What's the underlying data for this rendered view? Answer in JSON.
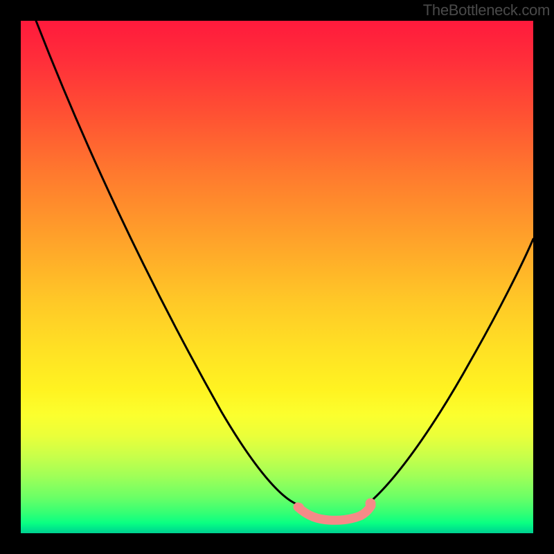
{
  "attribution": "TheBottleneck.com",
  "colors": {
    "background": "#000000",
    "curve": "#000000",
    "flat_segment": "#f58a88",
    "gradient_top": "#ff1a3c",
    "gradient_bottom": "#00d090"
  },
  "chart_data": {
    "type": "line",
    "title": "",
    "xlabel": "",
    "ylabel": "",
    "xlim": [
      0,
      100
    ],
    "ylim": [
      0,
      100
    ],
    "grid": false,
    "legend": false,
    "annotations": [],
    "series": [
      {
        "name": "left-curve",
        "x": [
          3,
          10,
          20,
          30,
          40,
          50,
          55
        ],
        "y": [
          100,
          82,
          62,
          44,
          27,
          12,
          6
        ]
      },
      {
        "name": "flat-segment",
        "x": [
          55,
          60,
          65,
          68
        ],
        "y": [
          6,
          5,
          5,
          6
        ]
      },
      {
        "name": "right-curve",
        "x": [
          68,
          75,
          82,
          90,
          100
        ],
        "y": [
          6,
          14,
          26,
          42,
          63
        ]
      }
    ],
    "notes": "V-shaped bottleneck curve on vertical rainbow gradient; y is visual height percentage of plot area; no axis ticks or numeric labels are rendered."
  }
}
